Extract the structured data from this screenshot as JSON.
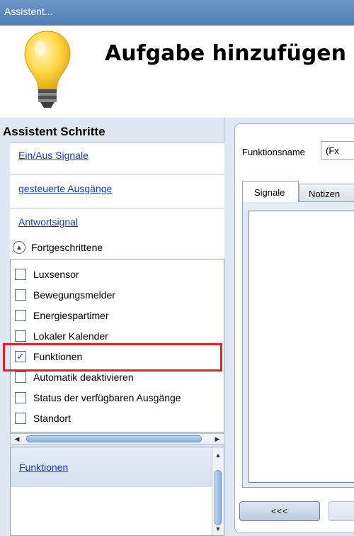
{
  "window": {
    "title": "Assistent..."
  },
  "header": {
    "title": "Aufgabe hinzufügen"
  },
  "steps": {
    "title": "Assistent Schritte",
    "links": [
      "Ein/Aus Signale",
      "gesteuerte Ausgänge",
      "Antwortsignal"
    ],
    "advanced_label": "Fortgeschrittene",
    "checklist": [
      {
        "label": "Luxsensor",
        "checked": false
      },
      {
        "label": "Bewegungsmelder",
        "checked": false
      },
      {
        "label": "Energiespartimer",
        "checked": false
      },
      {
        "label": "Lokaler Kalender",
        "checked": false
      },
      {
        "label": "Funktionen",
        "checked": true
      },
      {
        "label": "Automatik deaktivieren",
        "checked": false
      },
      {
        "label": "Status der verfügbaren Ausgänge",
        "checked": false
      },
      {
        "label": "Standort",
        "checked": false
      }
    ],
    "bottom_item": "Funktionen"
  },
  "function": {
    "name_label": "Funktionsname",
    "name_value": "(Fx",
    "tabs": [
      "Signale",
      "Notizen"
    ]
  },
  "footer": {
    "back_label": "<<<"
  },
  "colors": {
    "titlebar": "#5a87bf",
    "link": "#1a37b6",
    "highlight": "#e02424",
    "panel": "#dfe8f2"
  }
}
